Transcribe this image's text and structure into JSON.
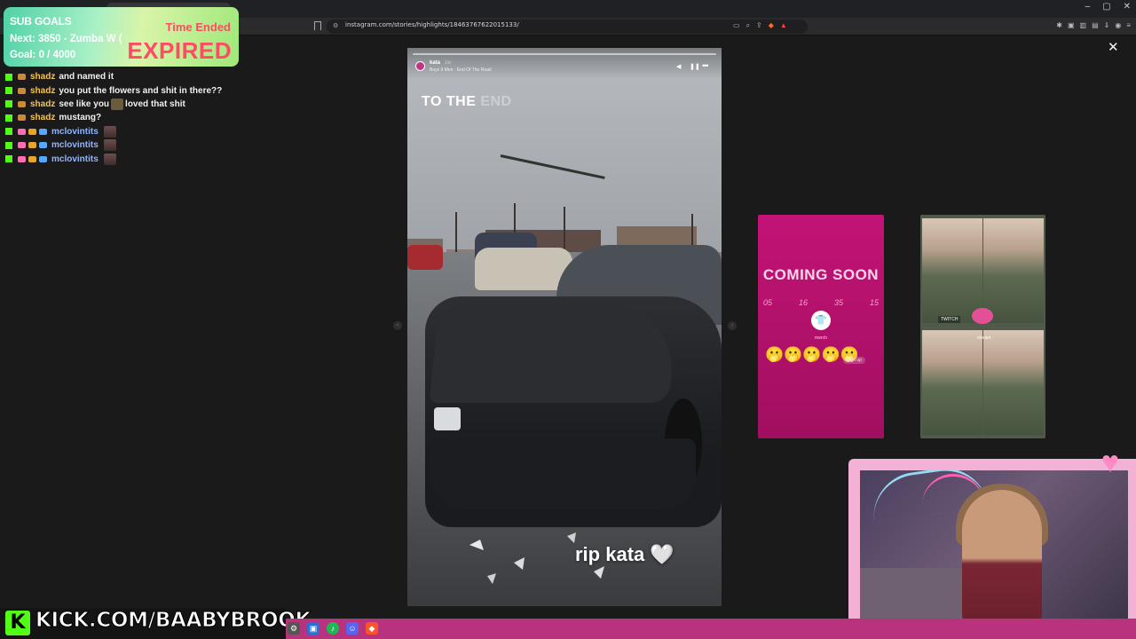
{
  "browser": {
    "url": "instagram.com/stories/highlights/18463767622015133/",
    "close_icon": "close-icon"
  },
  "sub_goals": {
    "title": "SUB GOALS",
    "next": "Next: 3850 - Zumba W (",
    "goal": "Goal: 0 / 4000",
    "time_ended": "Time Ended",
    "expired": "EXPIRED"
  },
  "chat": [
    {
      "user": "shadz",
      "message": "and named it",
      "user_color": "#f0c35d"
    },
    {
      "user": "shadz",
      "message": "you put the flowers and shit in there??",
      "user_color": "#f0c35d"
    },
    {
      "user": "shadz",
      "message": "see like you",
      "message2": "loved that shit",
      "user_color": "#f0c35d"
    },
    {
      "user": "shadz",
      "message": "mustang?",
      "user_color": "#f0c35d"
    },
    {
      "user": "mclovintits",
      "message": "",
      "user_color": "#8fb6ff"
    },
    {
      "user": "mclovintits",
      "message": "",
      "user_color": "#8fb6ff"
    },
    {
      "user": "mclovintits",
      "message": "",
      "user_color": "#8fb6ff"
    }
  ],
  "story": {
    "username": "kata",
    "time": "1w",
    "song": "Boyz II Men · End Of The Road",
    "overlay_text_1": "TO THE",
    "overlay_text_2": "END",
    "caption": "rip kata",
    "heart": "🤍"
  },
  "preview_coming_soon": {
    "title": "COMING SOON",
    "numbers": [
      "05",
      "16",
      "35",
      "15"
    ],
    "merch": "merch",
    "signup": "Sign up",
    "emojis": "🫢🫢🫢🫢🫢"
  },
  "preview_stream": {
    "twitch_label": "TWITCH",
    "stream_label": "stream"
  },
  "bottom": {
    "kick_k": "K",
    "kick_url": "KICK.COM/BAABYBROOK"
  },
  "colors": {
    "kick_green": "#53fc18",
    "expired_red": "#ff4b64",
    "coming_soon_bg": "#c21376",
    "webcam_frame": "#f3b2d5",
    "taskbar": "#b8327e"
  }
}
